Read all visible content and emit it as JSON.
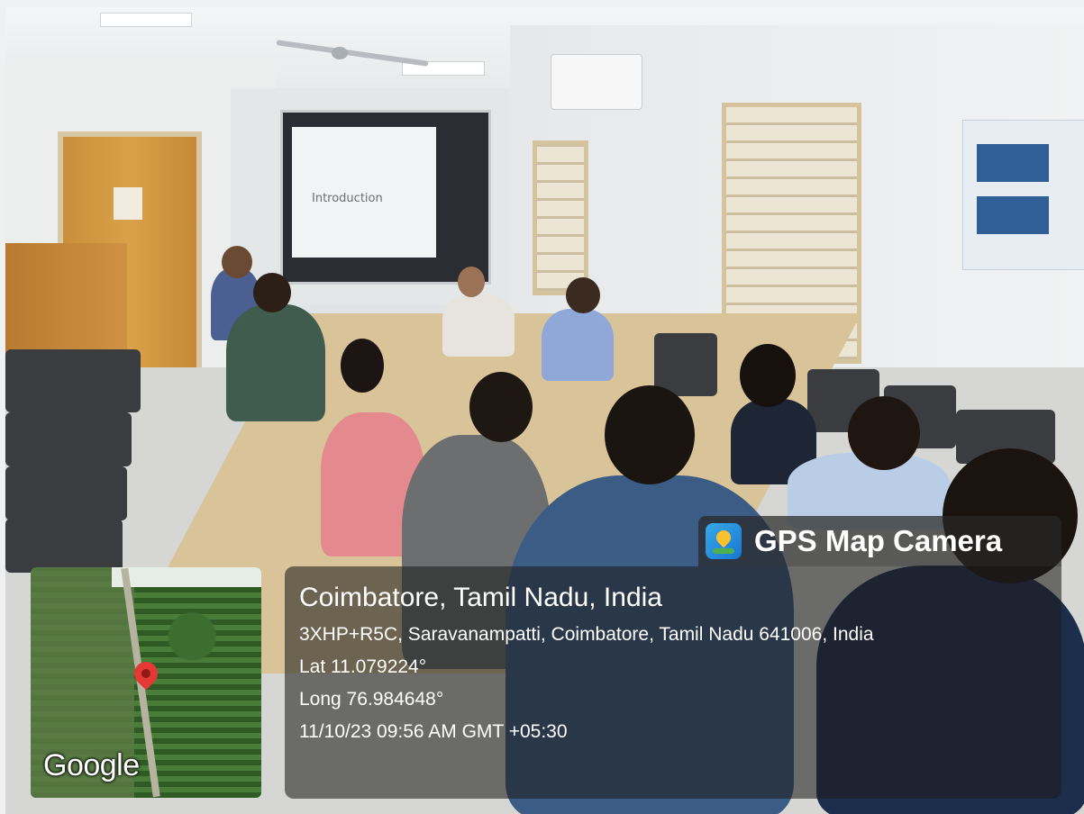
{
  "slide": {
    "heading": "Introduction"
  },
  "overlay": {
    "badge": {
      "app_name": "GPS Map Camera",
      "icon": "map-pin-icon"
    },
    "location": {
      "city": "Coimbatore, Tamil Nadu, India",
      "address": "3XHP+R5C, Saravanampatti, Coimbatore, Tamil Nadu 641006, India",
      "lat": "Lat 11.079224°",
      "long": "Long 76.984648°",
      "datetime": "11/10/23 09:56 AM GMT +05:30"
    },
    "map": {
      "brand": "Google"
    }
  }
}
